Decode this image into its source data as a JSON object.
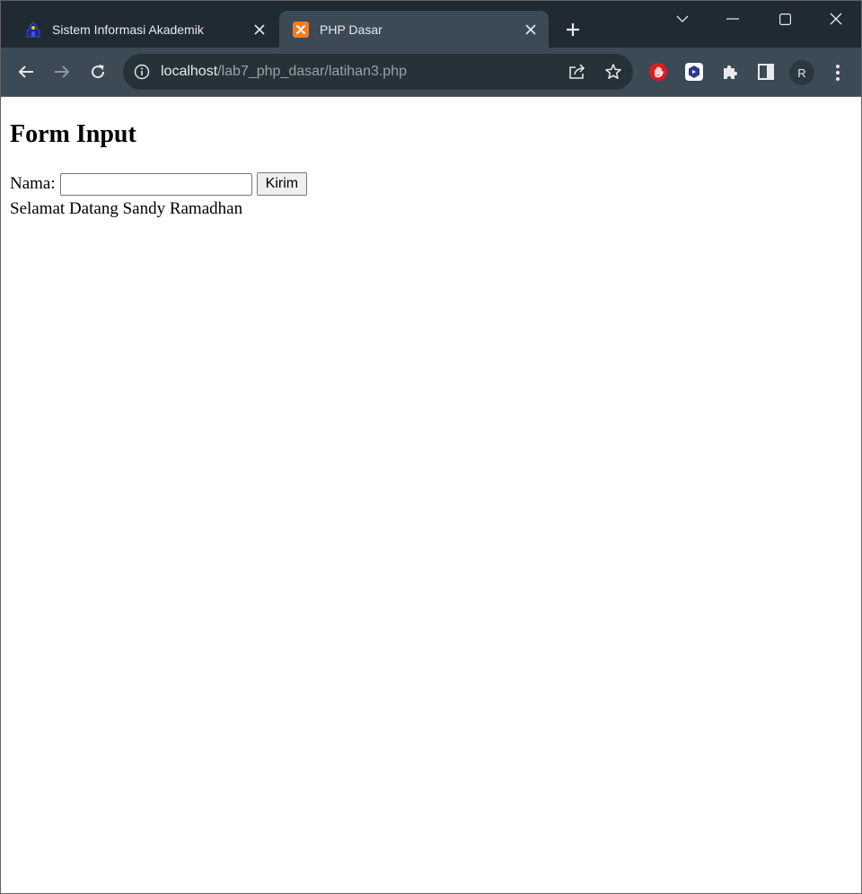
{
  "browser": {
    "tabs": [
      {
        "title": "Sistem Informasi Akademik",
        "active": false
      },
      {
        "title": "PHP Dasar",
        "active": true
      }
    ],
    "address_bar": {
      "host": "localhost",
      "path": "/lab7_php_dasar/latihan3.php"
    },
    "profile_initial": "R",
    "icons": {
      "back": "arrow-left-icon",
      "forward": "arrow-right-icon",
      "reload": "reload-icon",
      "site_info": "info-icon",
      "share": "share-icon",
      "bookmark": "star-icon",
      "extensions": "puzzle-icon",
      "side_panel": "side-panel-icon",
      "menu": "kebab-menu-icon"
    },
    "colors": {
      "tabstrip_bg": "#202a32",
      "toolbar_bg": "#3b4a55",
      "omnibox_bg": "#26323a"
    }
  },
  "page": {
    "heading": "Form Input",
    "form": {
      "label": "Nama:",
      "input_value": "",
      "submit_label": "Kirim"
    },
    "greeting": "Selamat Datang Sandy Ramadhan"
  }
}
